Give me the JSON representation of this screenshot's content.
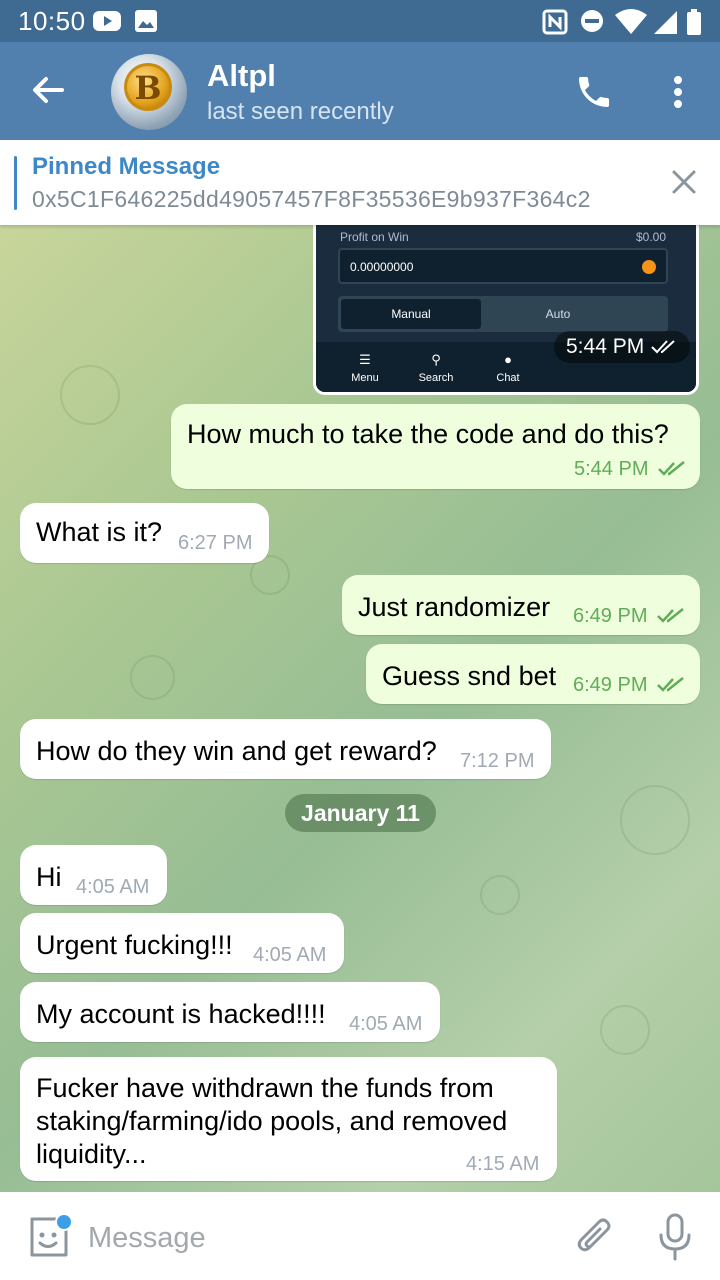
{
  "status_bar": {
    "time": "10:50"
  },
  "header": {
    "name": "Altpl",
    "status": "last seen recently",
    "avatar_letter": "B"
  },
  "pinned": {
    "title": "Pinned Message",
    "text": "0x5C1F646225dd49057457F8F35536E9b937F364c2"
  },
  "screenshot": {
    "label": "Profit on Win",
    "amount": "$0.00",
    "value": "0.00000000",
    "tab_manual": "Manual",
    "tab_auto": "Auto",
    "nav": [
      "Menu",
      "Search",
      "Chat"
    ],
    "time": "5:44 PM"
  },
  "messages": [
    {
      "dir": "out",
      "text": "How much to take the code and do this?",
      "time": "5:44 PM"
    },
    {
      "dir": "in",
      "text": "What is it?",
      "time": "6:27 PM"
    },
    {
      "dir": "out",
      "text": "Just randomizer",
      "time": "6:49 PM"
    },
    {
      "dir": "out",
      "text": "Guess snd bet",
      "time": "6:49 PM"
    },
    {
      "dir": "in",
      "text": "How do they win and get reward?",
      "time": "7:12 PM"
    },
    {
      "dir": "in",
      "text": "Hi",
      "time": "4:05 AM"
    },
    {
      "dir": "in",
      "text": "Urgent fucking!!!",
      "time": "4:05 AM"
    },
    {
      "dir": "in",
      "text": "My account is hacked!!!!",
      "time": "4:05 AM"
    },
    {
      "dir": "in",
      "text_lines": [
        "Fucker have withdrawn the funds from",
        "staking/farming/ido pools, and removed",
        "liquidity..."
      ],
      "time": "4:15 AM"
    }
  ],
  "date_separator": "January 11",
  "composer": {
    "placeholder": "Message"
  },
  "colors": {
    "header": "#5180ae",
    "status_bar": "#3f6a92",
    "accent": "#3e88c7",
    "outgoing_bubble": "#effedd",
    "check": "#5fad56"
  }
}
